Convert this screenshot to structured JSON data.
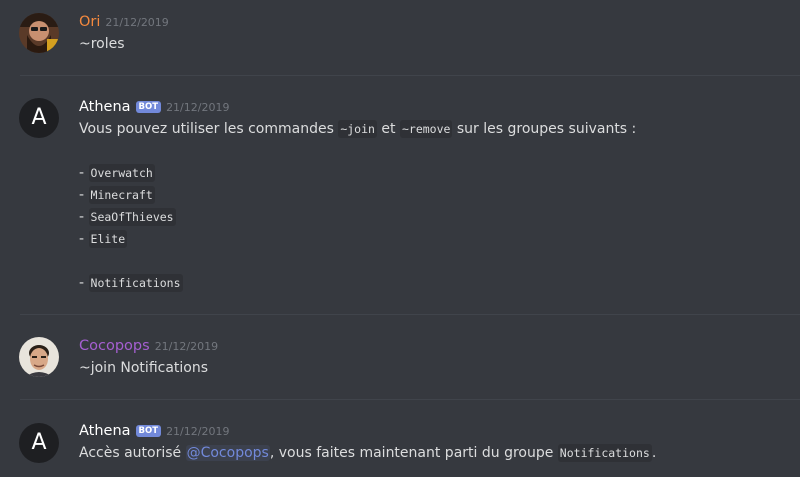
{
  "colors": {
    "background": "#36393f",
    "text": "#dcddde",
    "timestamp": "#72767d",
    "bot_tag": "#7289da",
    "mention": "#7289da",
    "ori": "#f4893e",
    "athena": "#ffffff",
    "cocopops": "#a55fd1"
  },
  "messages": [
    {
      "author": "Ori",
      "timestamp": "21/12/2019",
      "avatar_icon": "bearded-man-avatar",
      "text": "~roles"
    },
    {
      "author": "Athena",
      "bot_tag": "BOT",
      "timestamp": "21/12/2019",
      "avatar_letter": "A",
      "intro_before": "Vous pouvez utiliser les commandes ",
      "cmd_join": "~join",
      "intro_mid": " et ",
      "cmd_remove": "~remove",
      "intro_after": " sur les groupes suivants :",
      "list_prefix": "- ",
      "groups": [
        "Overwatch",
        "Minecraft",
        "SeaOfThieves",
        "Elite"
      ],
      "extra_group": "Notifications"
    },
    {
      "author": "Cocopops",
      "timestamp": "21/12/2019",
      "avatar_icon": "man-face-avatar",
      "text": "~join Notifications"
    },
    {
      "author": "Athena",
      "bot_tag": "BOT",
      "timestamp": "21/12/2019",
      "avatar_letter": "A",
      "text_before": "Accès autorisé ",
      "mention": "@Cocopops",
      "text_mid": ", vous faites maintenant parti du groupe ",
      "group_code": "Notifications",
      "text_after": "."
    }
  ]
}
